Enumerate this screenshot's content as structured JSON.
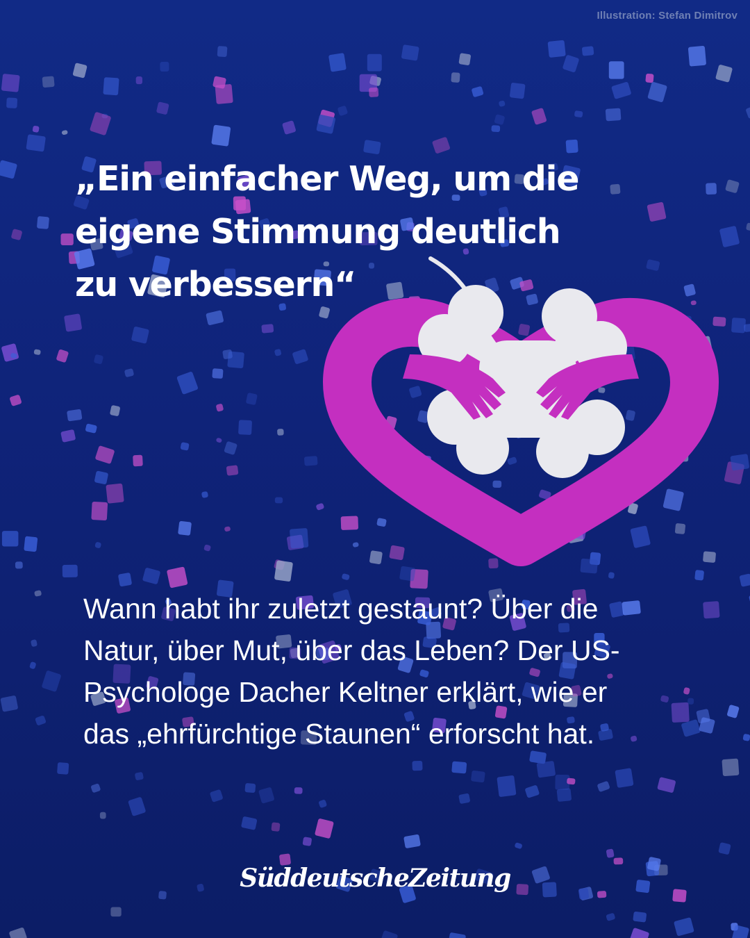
{
  "credit": "Illustration: Stefan Dimitrov",
  "headline": {
    "lines": [
      "„Ein einfacher Weg, um die",
      "eigene Stimmung deutlich",
      "zu verbessern“"
    ]
  },
  "teaser": {
    "lines": [
      "Wann habt ihr zuletzt gestaunt? Über die",
      "Natur, über Mut, über das Leben? Der US-",
      "Psychologe Dacher Keltner erklärt, wie er",
      "das „ehrfürchtige Staunen“ erforscht hat."
    ]
  },
  "brand": "SüddeutscheZeitung",
  "illustration": {
    "subject": "heart-with-hands-hugging-four-leaf-clover",
    "colors": {
      "heart": "#c42fc0",
      "clover": "#e9e9ee",
      "background": "#0f2378"
    }
  },
  "colors": {
    "background": "#0f2378",
    "confetti": [
      "#3a5fd9",
      "#5a7df0",
      "#7e4fd6",
      "#9aa6c9",
      "#c84fc9",
      "#2c49b8"
    ]
  }
}
